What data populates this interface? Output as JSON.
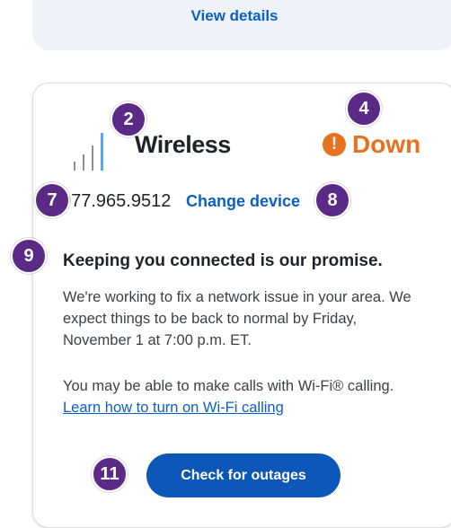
{
  "top_card": {
    "link_label": "View details"
  },
  "service": {
    "name": "Wireless",
    "status_icon": "!",
    "status_label": "Down",
    "status_color": "#e8711f",
    "phone": "977.965.9512",
    "change_device_label": "Change device"
  },
  "message": {
    "heading": "Keeping you connected is our promise.",
    "paragraph1": "We're working to fix a network issue in your area. We expect things to be back to normal by Friday, November 1 at 7:00 p.m. ET.",
    "paragraph2_text": "You may be able to make calls with Wi-Fi® calling. ",
    "paragraph2_link": "Learn how to turn on Wi-Fi calling"
  },
  "button": {
    "label": "Check for outages"
  },
  "callouts": [
    "2",
    "4",
    "7",
    "8",
    "9",
    "11"
  ],
  "colors": {
    "accent": "#0b5fc4",
    "button": "#0d57b8",
    "callout": "#5b2a86"
  }
}
